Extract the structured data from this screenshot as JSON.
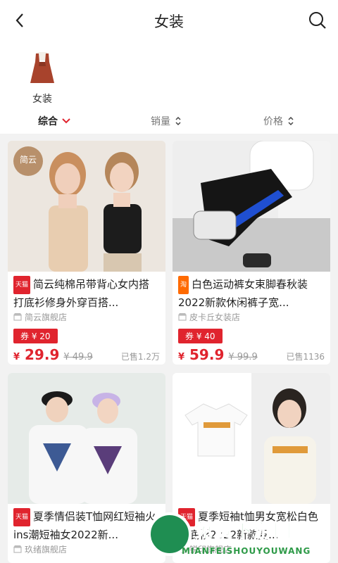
{
  "header": {
    "title": "女装"
  },
  "category": {
    "label": "女装"
  },
  "sort": {
    "composite": "综合",
    "sales": "销量",
    "price": "价格"
  },
  "products": [
    {
      "brand_tag": "简云",
      "platform": "天猫",
      "title": "简云纯棉吊带背心女内搭打底衫修身外穿百搭...",
      "shop": "简云旗舰店",
      "coupon": "券 ¥ 20",
      "price": "29.9",
      "old_price": "¥ 49.9",
      "sold": "已售1.2万"
    },
    {
      "platform": "淘",
      "title": "白色运动裤女束脚春秋装2022新款休闲裤子宽...",
      "shop": "皮卡丘女装店",
      "coupon": "券 ¥ 40",
      "price": "59.9",
      "old_price": "¥ 99.9",
      "sold": "已售1136"
    },
    {
      "platform": "天猫",
      "title": "夏季情侣装T恤网红短袖火ins潮短袖女2022新...",
      "shop": "玖绪旗舰店"
    },
    {
      "platform": "天猫",
      "title": "夏季短袖t恤男女宽松白色打底衫2022新款夏...",
      "shop": "锐印旗舰店"
    }
  ],
  "currency": "¥",
  "watermark": {
    "text": "免费下游网",
    "sub": "MIANFEISHOUYOUWANG"
  }
}
